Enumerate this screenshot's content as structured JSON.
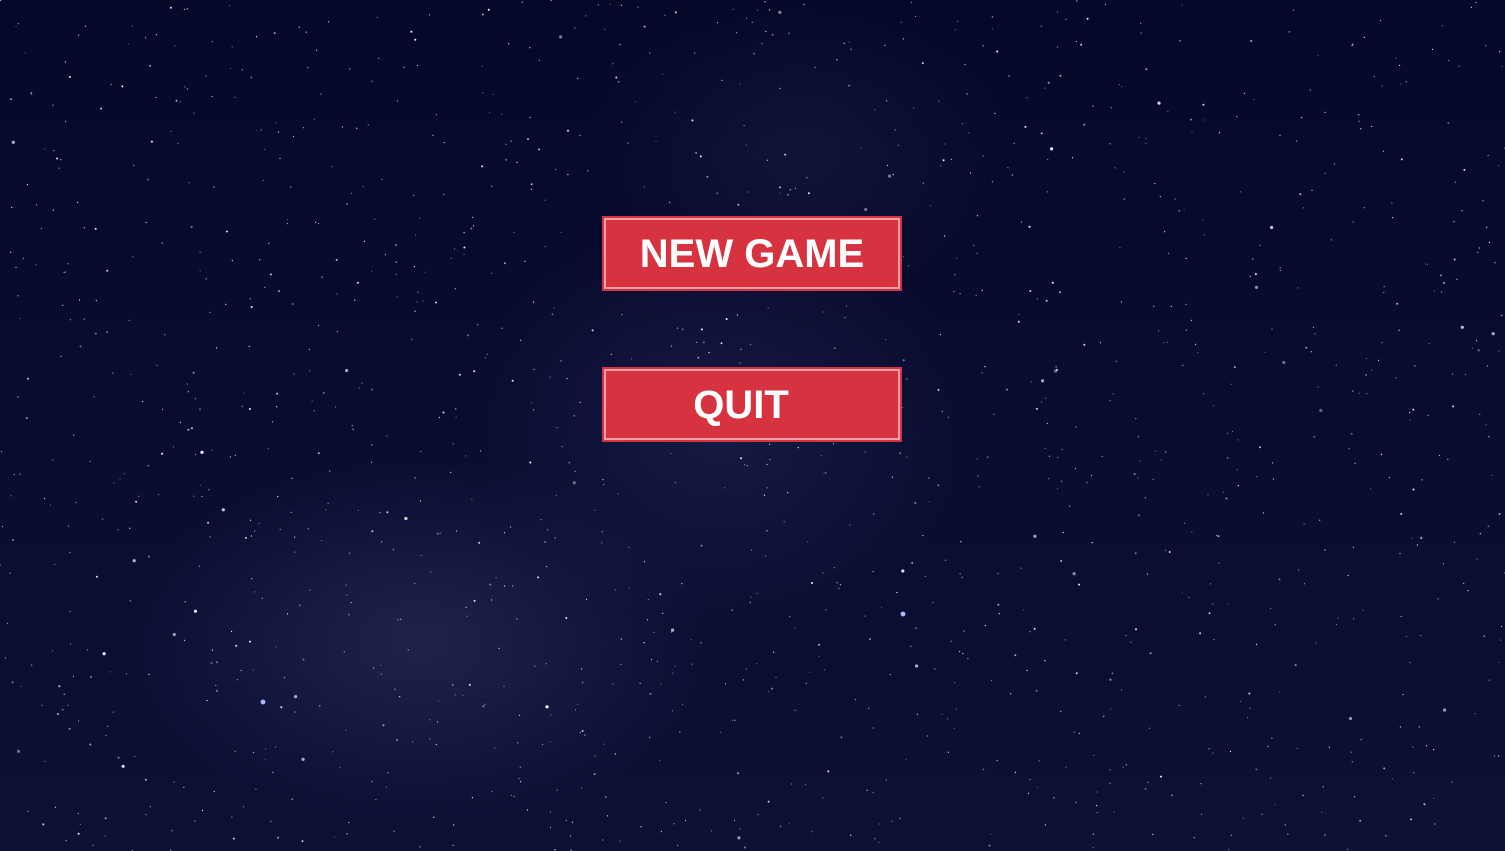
{
  "menu": {
    "new_game_label": "NEW GAME",
    "quit_label": "QUIT"
  },
  "colors": {
    "background": "#050a2a",
    "button_fill": "#d63240",
    "button_border": "#f0a0a8",
    "button_text": "#ffffff"
  }
}
